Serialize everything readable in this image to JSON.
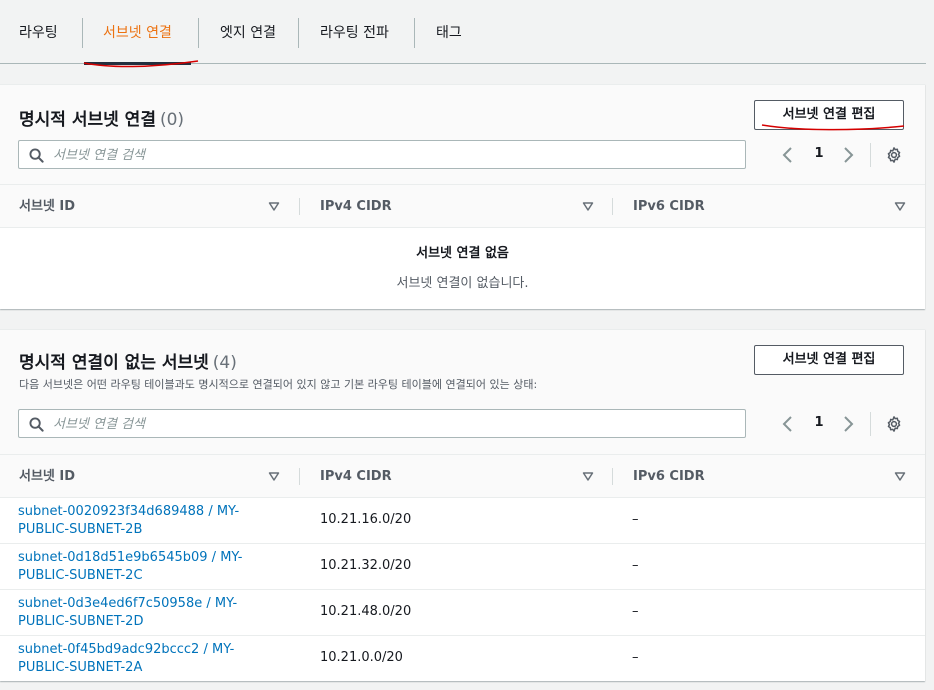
{
  "tabs": [
    {
      "label": "라우팅"
    },
    {
      "label": "서브넷 연결"
    },
    {
      "label": "엣지 연결"
    },
    {
      "label": "라우팅 전파"
    },
    {
      "label": "태그"
    }
  ],
  "active_tab_index": 1,
  "explicit_panel": {
    "title": "명시적 서브넷 연결",
    "count": "(0)",
    "edit_button": "서브넷 연결 편집",
    "search_placeholder": "서브넷 연결 검색",
    "page": "1",
    "columns": [
      "서브넷 ID",
      "IPv4 CIDR",
      "IPv6 CIDR"
    ],
    "empty_title": "서브넷 연결 없음",
    "empty_message": "서브넷 연결이 없습니다."
  },
  "implicit_panel": {
    "title": "명시적 연결이 없는 서브넷",
    "count": "(4)",
    "description": "다음 서브넷은 어떤 라우팅 테이블과도 명시적으로 연결되어 있지 않고 기본 라우팅 테이블에 연결되어 있는 상태:",
    "edit_button": "서브넷 연결 편집",
    "search_placeholder": "서브넷 연결 검색",
    "page": "1",
    "columns": [
      "서브넷 ID",
      "IPv4 CIDR",
      "IPv6 CIDR"
    ],
    "rows": [
      {
        "subnet_line1": "subnet-0020923f34d689488 / MY-",
        "subnet_line2": "PUBLIC-SUBNET-2B",
        "ipv4": "10.21.16.0/20",
        "ipv6": "–"
      },
      {
        "subnet_line1": "subnet-0d18d51e9b6545b09 / MY-",
        "subnet_line2": "PUBLIC-SUBNET-2C",
        "ipv4": "10.21.32.0/20",
        "ipv6": "–"
      },
      {
        "subnet_line1": "subnet-0d3e4ed6f7c50958e / MY-",
        "subnet_line2": "PUBLIC-SUBNET-2D",
        "ipv4": "10.21.48.0/20",
        "ipv6": "–"
      },
      {
        "subnet_line1": "subnet-0f45bd9adc92bccc2 / MY-",
        "subnet_line2": "PUBLIC-SUBNET-2A",
        "ipv4": "10.21.0.0/20",
        "ipv6": "–"
      }
    ]
  },
  "colors": {
    "accent": "#ec7211",
    "link": "#0073bb",
    "annotation": "#d50000"
  },
  "icons": [
    "search-icon",
    "chevron-left-icon",
    "chevron-right-icon",
    "gear-icon",
    "sort-caret-icon"
  ]
}
